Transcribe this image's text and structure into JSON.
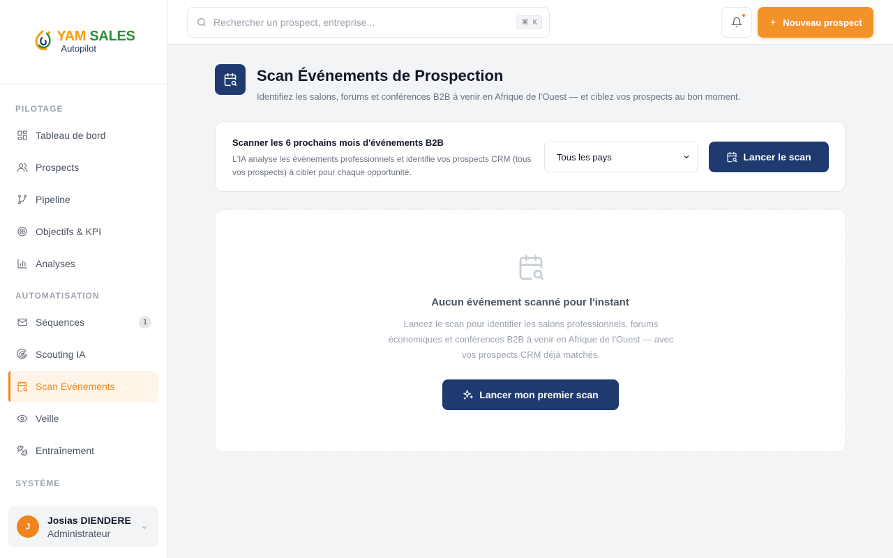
{
  "brand": {
    "name_part1": "YAM",
    "name_part2": "SALES",
    "subtitle": "Autopilot",
    "logo_icon": "flame-swirl-logo"
  },
  "search": {
    "placeholder": "Rechercher un prospect, entreprise...",
    "shortcut_symbol": "⌘",
    "shortcut_key": "K"
  },
  "header": {
    "new_prospect_label": "Nouveau prospect",
    "notification_dot_color": "#f0851f"
  },
  "sidebar": {
    "sections": [
      {
        "label": "PILOTAGE"
      },
      {
        "label": "AUTOMATISATION"
      },
      {
        "label": "SYSTÈME"
      }
    ],
    "items": [
      {
        "label": "Tableau de bord",
        "icon": "dashboard-icon"
      },
      {
        "label": "Prospects",
        "icon": "users-icon"
      },
      {
        "label": "Pipeline",
        "icon": "git-branch-icon"
      },
      {
        "label": "Objectifs & KPI",
        "icon": "target-icon"
      },
      {
        "label": "Analyses",
        "icon": "bar-chart-icon"
      },
      {
        "label": "Séquences",
        "icon": "mail-icon",
        "badge": "1"
      },
      {
        "label": "Scouting IA",
        "icon": "radar-icon"
      },
      {
        "label": "Scan Événements",
        "icon": "calendar-search-icon",
        "active": true
      },
      {
        "label": "Veille",
        "icon": "eye-icon"
      },
      {
        "label": "Entraînement",
        "icon": "dumbbell-icon"
      }
    ]
  },
  "user": {
    "initial": "J",
    "name": "Josias DIENDERE",
    "role": "Administrateur"
  },
  "page": {
    "title": "Scan Événements de Prospection",
    "subtitle": "Identifiez les salons, forums et conférences B2B à venir en Afrique de l'Ouest — et ciblez vos prospects au bon moment."
  },
  "scan": {
    "title": "Scanner les 6 prochains mois d'événements B2B",
    "description": "L'IA analyse les événements professionnels et identifie vos prospects CRM (tous vos prospects) à cibler pour chaque opportunité.",
    "country_selected": "Tous les pays",
    "button_label": "Lancer le scan"
  },
  "empty_state": {
    "title": "Aucun événement scanné pour l'instant",
    "description": "Lancez le scan pour identifier les salons professionnels, forums économiques et conférences B2B à venir en Afrique de l'Ouest — avec vos prospects CRM déjà matchés.",
    "button_label": "Lancer mon premier scan"
  },
  "colors": {
    "accent": "#f0851f",
    "navy": "#1e3a6e",
    "brand_green": "#2e8b3a"
  }
}
